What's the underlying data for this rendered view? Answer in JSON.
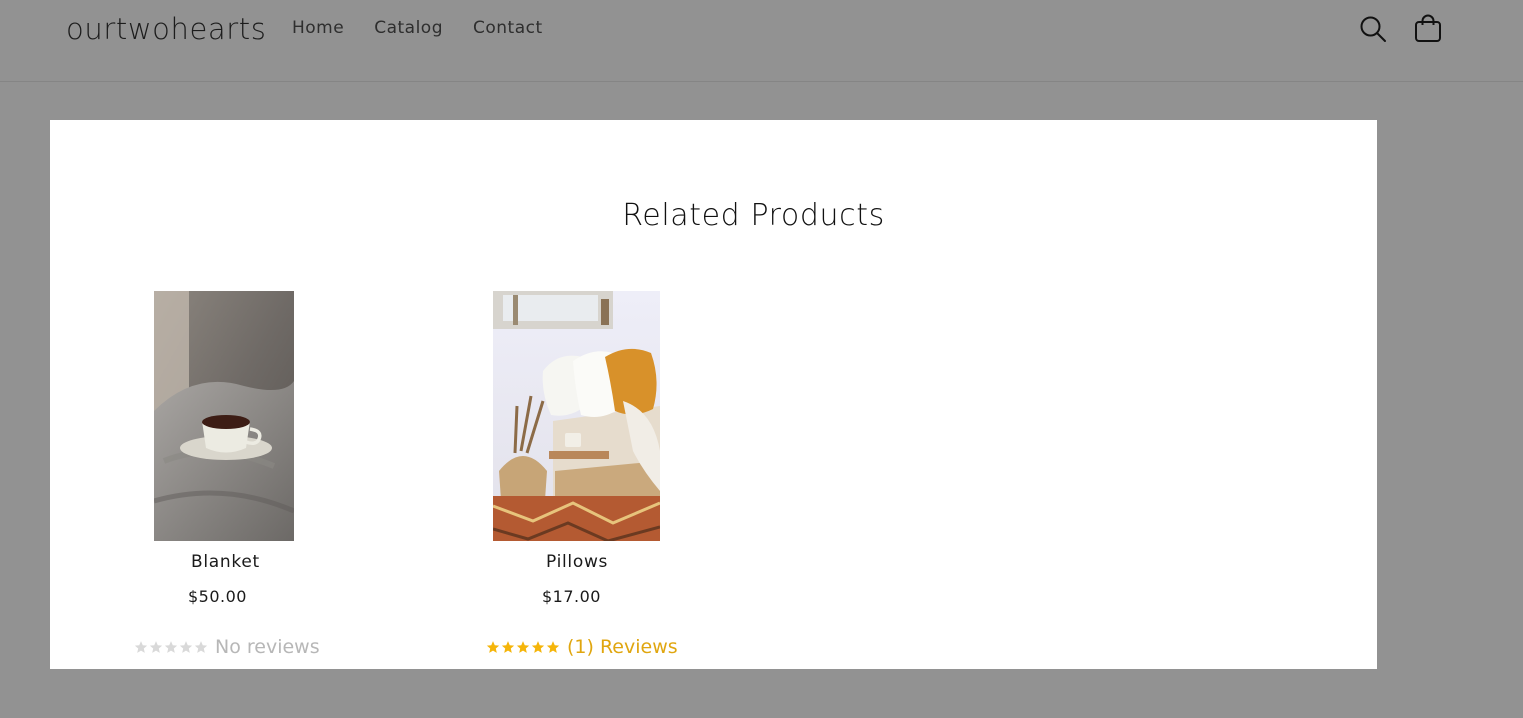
{
  "header": {
    "brand": "ourtwohearts",
    "nav": [
      "Home",
      "Catalog",
      "Contact"
    ],
    "icons": {
      "search": "search-icon",
      "cart": "cart-icon"
    }
  },
  "modal": {
    "title": "Related Products",
    "products": [
      {
        "name": "Blanket",
        "price": "$50.00",
        "rating": 0,
        "reviews_text": "No reviews",
        "image": "cup of tea on grey knit blanket"
      },
      {
        "name": "Pillows",
        "price": "$17.00",
        "rating": 5,
        "reviews_text": "(1) Reviews",
        "image": "bed with white and mustard pillows, basket and patterned rug"
      }
    ]
  },
  "colors": {
    "overlay": "#929292",
    "modal_bg": "#ffffff",
    "star_filled": "#f5b50a",
    "star_empty": "#d9d9d9",
    "reviews_link": "#e0a60f"
  }
}
